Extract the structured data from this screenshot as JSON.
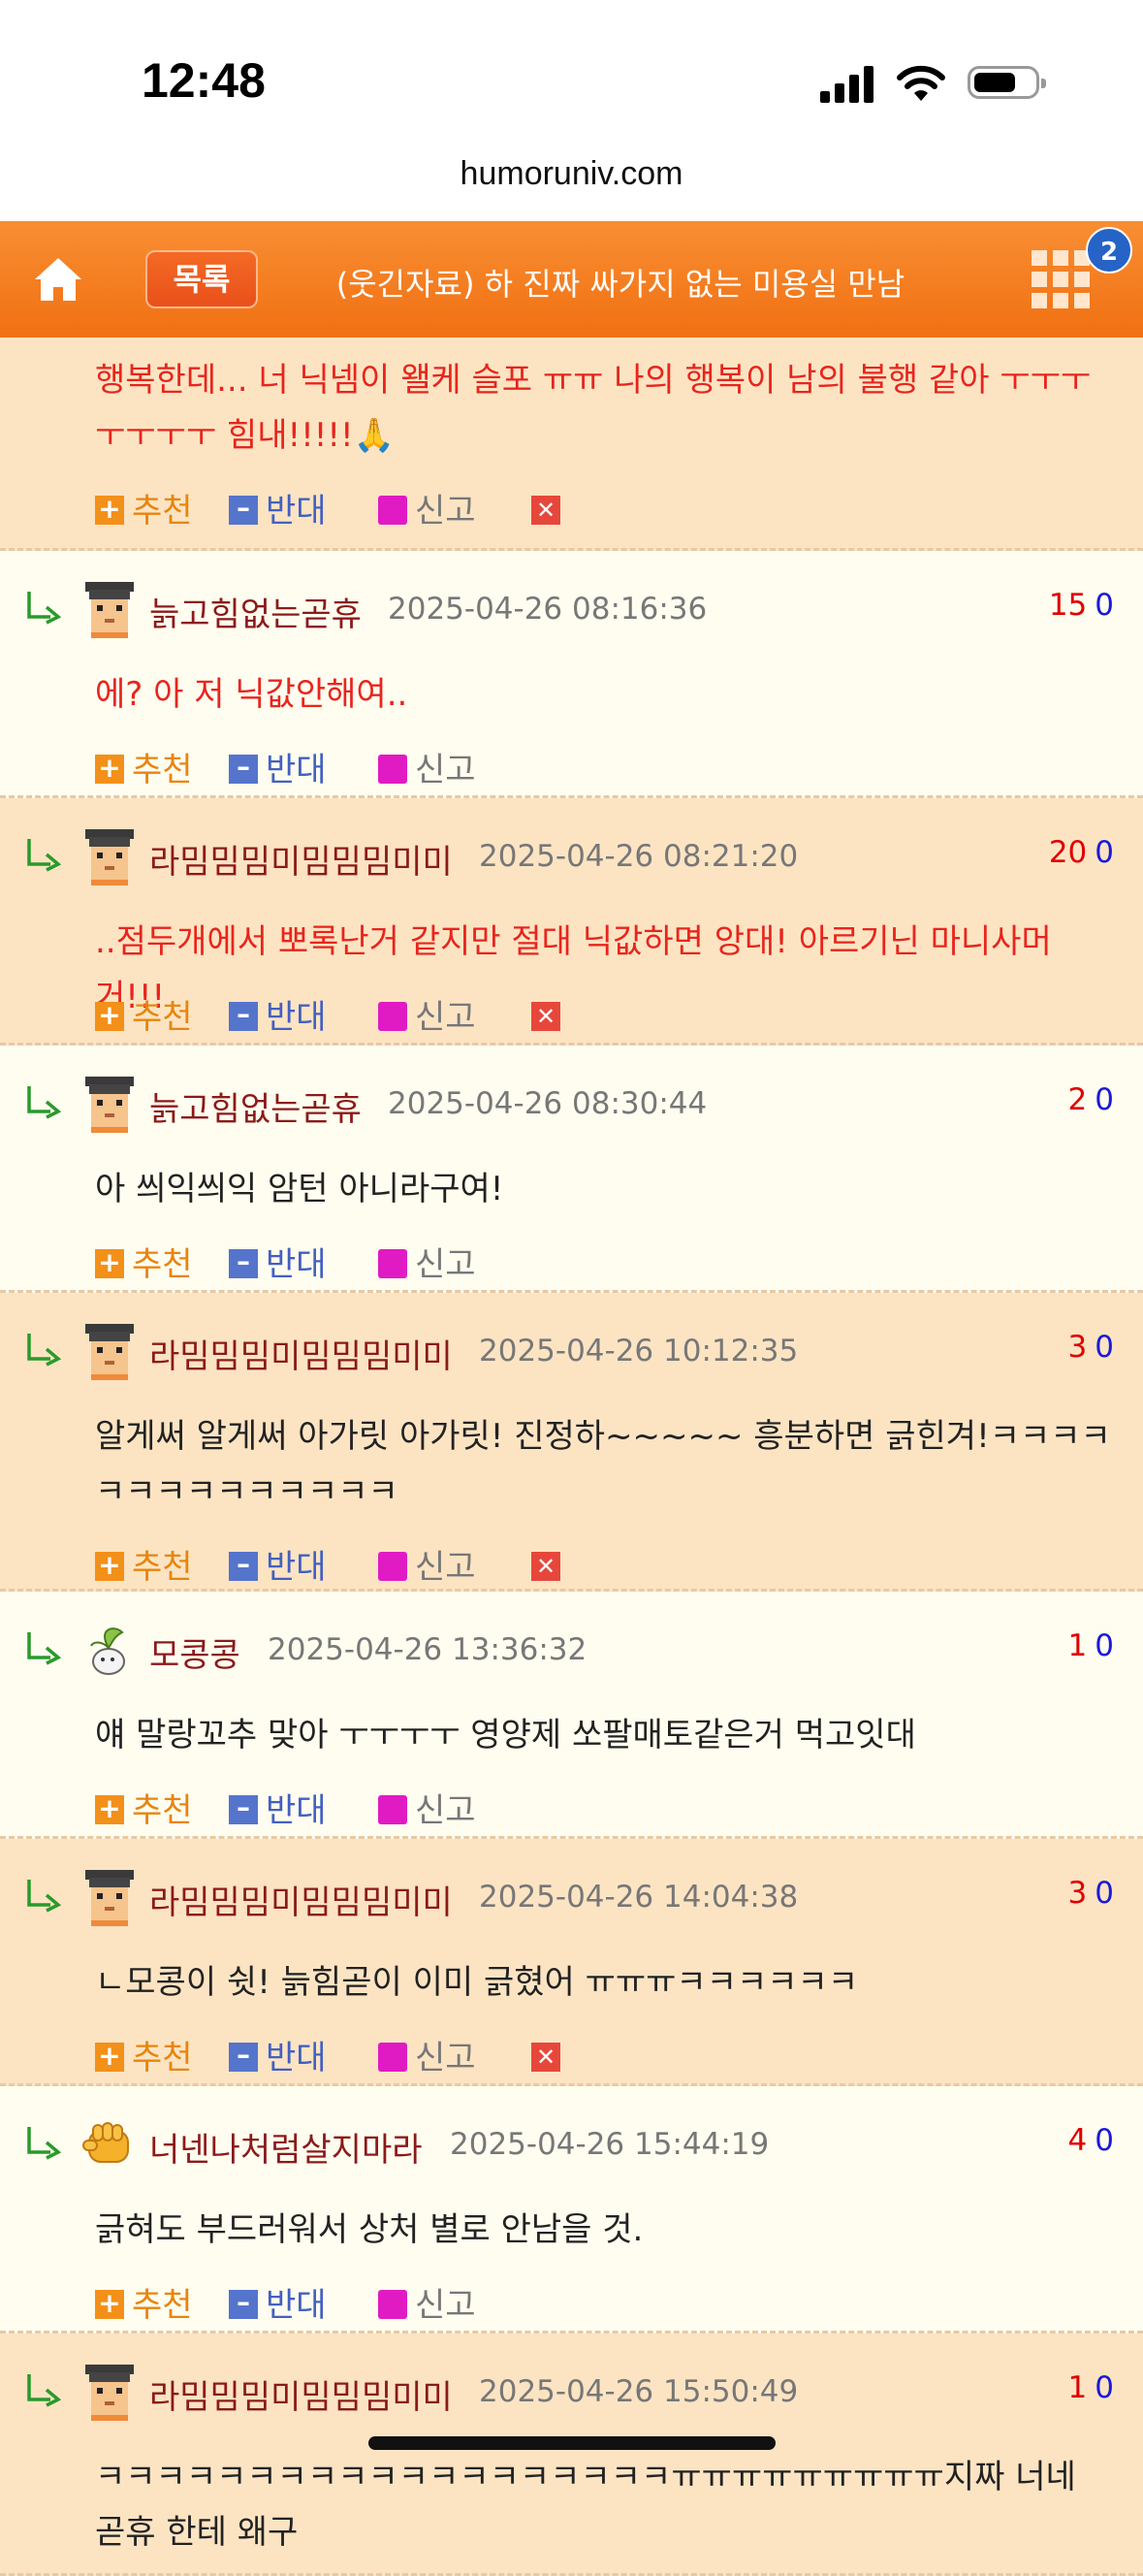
{
  "status": {
    "time": "12:48"
  },
  "browser": {
    "url": "humoruniv.com"
  },
  "topbar": {
    "list_label": "목록",
    "title": "(웃긴자료) 하 진짜 싸가지 없는 미용실 만남",
    "badge_count": "2"
  },
  "labels": {
    "recommend": "추천",
    "oppose": "반대",
    "report": "신고"
  },
  "colors": {
    "header_orange": "#f07012",
    "odd_row_bg": "#fce4c3",
    "even_row_bg": "#fffdf0",
    "up_vote": "#e00000",
    "down_vote": "#1a1ad8"
  },
  "comments": [
    {
      "text": "행복한데... 너 닉넴이 왤케 슬포 ㅠㅠ 나의 행복이 남의 불행 같아 ㅜㅜㅜㅜㅜㅜㅜ 힘내!!!!!🙏",
      "text_red": true,
      "delete": true,
      "partial": true,
      "bg": "orange"
    },
    {
      "nick": "늙고힘없는곧휴",
      "date": "2025-04-26 08:16:36",
      "up": "15",
      "down": "0",
      "text": "에? 아 저 닉값안해여..",
      "text_red": true,
      "delete": false,
      "bg": "light",
      "avatar": "pixel-icon"
    },
    {
      "nick": "라밈밈밈미밈밈밈미미",
      "date": "2025-04-26 08:21:20",
      "up": "20",
      "down": "0",
      "text": "..점두개에서 뽀록난거 같지만 절대 닉값하면 앙대! 아르기닌 마니사머거!!!",
      "text_red": true,
      "delete": true,
      "bg": "orange",
      "avatar": "pixel-icon"
    },
    {
      "nick": "늙고힘없는곧휴",
      "date": "2025-04-26 08:30:44",
      "up": "2",
      "down": "0",
      "text": "아 씌익씌익 암턴 아니라구여!",
      "text_red": false,
      "delete": false,
      "bg": "light",
      "avatar": "pixel-icon"
    },
    {
      "nick": "라밈밈밈미밈밈밈미미",
      "date": "2025-04-26 10:12:35",
      "up": "3",
      "down": "0",
      "text": "알게써 알게써 아가릿 아가릿! 진정하~~~~~ 흥분하면 긁힌겨!ㅋㅋㅋㅋㅋㅋㅋㅋㅋㅋㅋㅋㅋㅋ",
      "text_red": false,
      "delete": true,
      "bg": "orange",
      "avatar": "pixel-icon"
    },
    {
      "nick": "모콩콩",
      "date": "2025-04-26 13:36:32",
      "up": "1",
      "down": "0",
      "text": "얘 말랑꼬추 맞아 ㅜㅜㅜㅜ 영양제 쏘팔매토같은거 먹고잇대",
      "text_red": false,
      "delete": false,
      "bg": "light",
      "avatar": "plant-icon"
    },
    {
      "nick": "라밈밈밈미밈밈밈미미",
      "date": "2025-04-26 14:04:38",
      "up": "3",
      "down": "0",
      "text": "ㄴ모콩이 쉿! 늙힘곧이 이미 긁혔어 ㅠㅠㅠㅋㅋㅋㅋㅋㅋ",
      "text_red": false,
      "delete": true,
      "bg": "orange",
      "avatar": "pixel-icon"
    },
    {
      "nick": "너넨나처럼살지마라",
      "date": "2025-04-26 15:44:19",
      "up": "4",
      "down": "0",
      "text": "긁혀도 부드러워서 상처 별로 안남을 것.",
      "text_red": false,
      "delete": false,
      "bg": "light",
      "avatar": "fist-icon"
    },
    {
      "nick": "라밈밈밈미밈밈밈미미",
      "date": "2025-04-26 15:50:49",
      "up": "1",
      "down": "0",
      "text": "ㅋㅋㅋㅋㅋㅋㅋㅋㅋㅋㅋㅋㅋㅋㅋㅋㅋㅋㅋㅠㅠㅠㅠㅠㅠㅠㅠㅠ지짜 너네 곧휴 한테 왜구",
      "text_red": false,
      "delete": false,
      "bg": "orange",
      "avatar": "pixel-icon",
      "cut": true
    }
  ]
}
